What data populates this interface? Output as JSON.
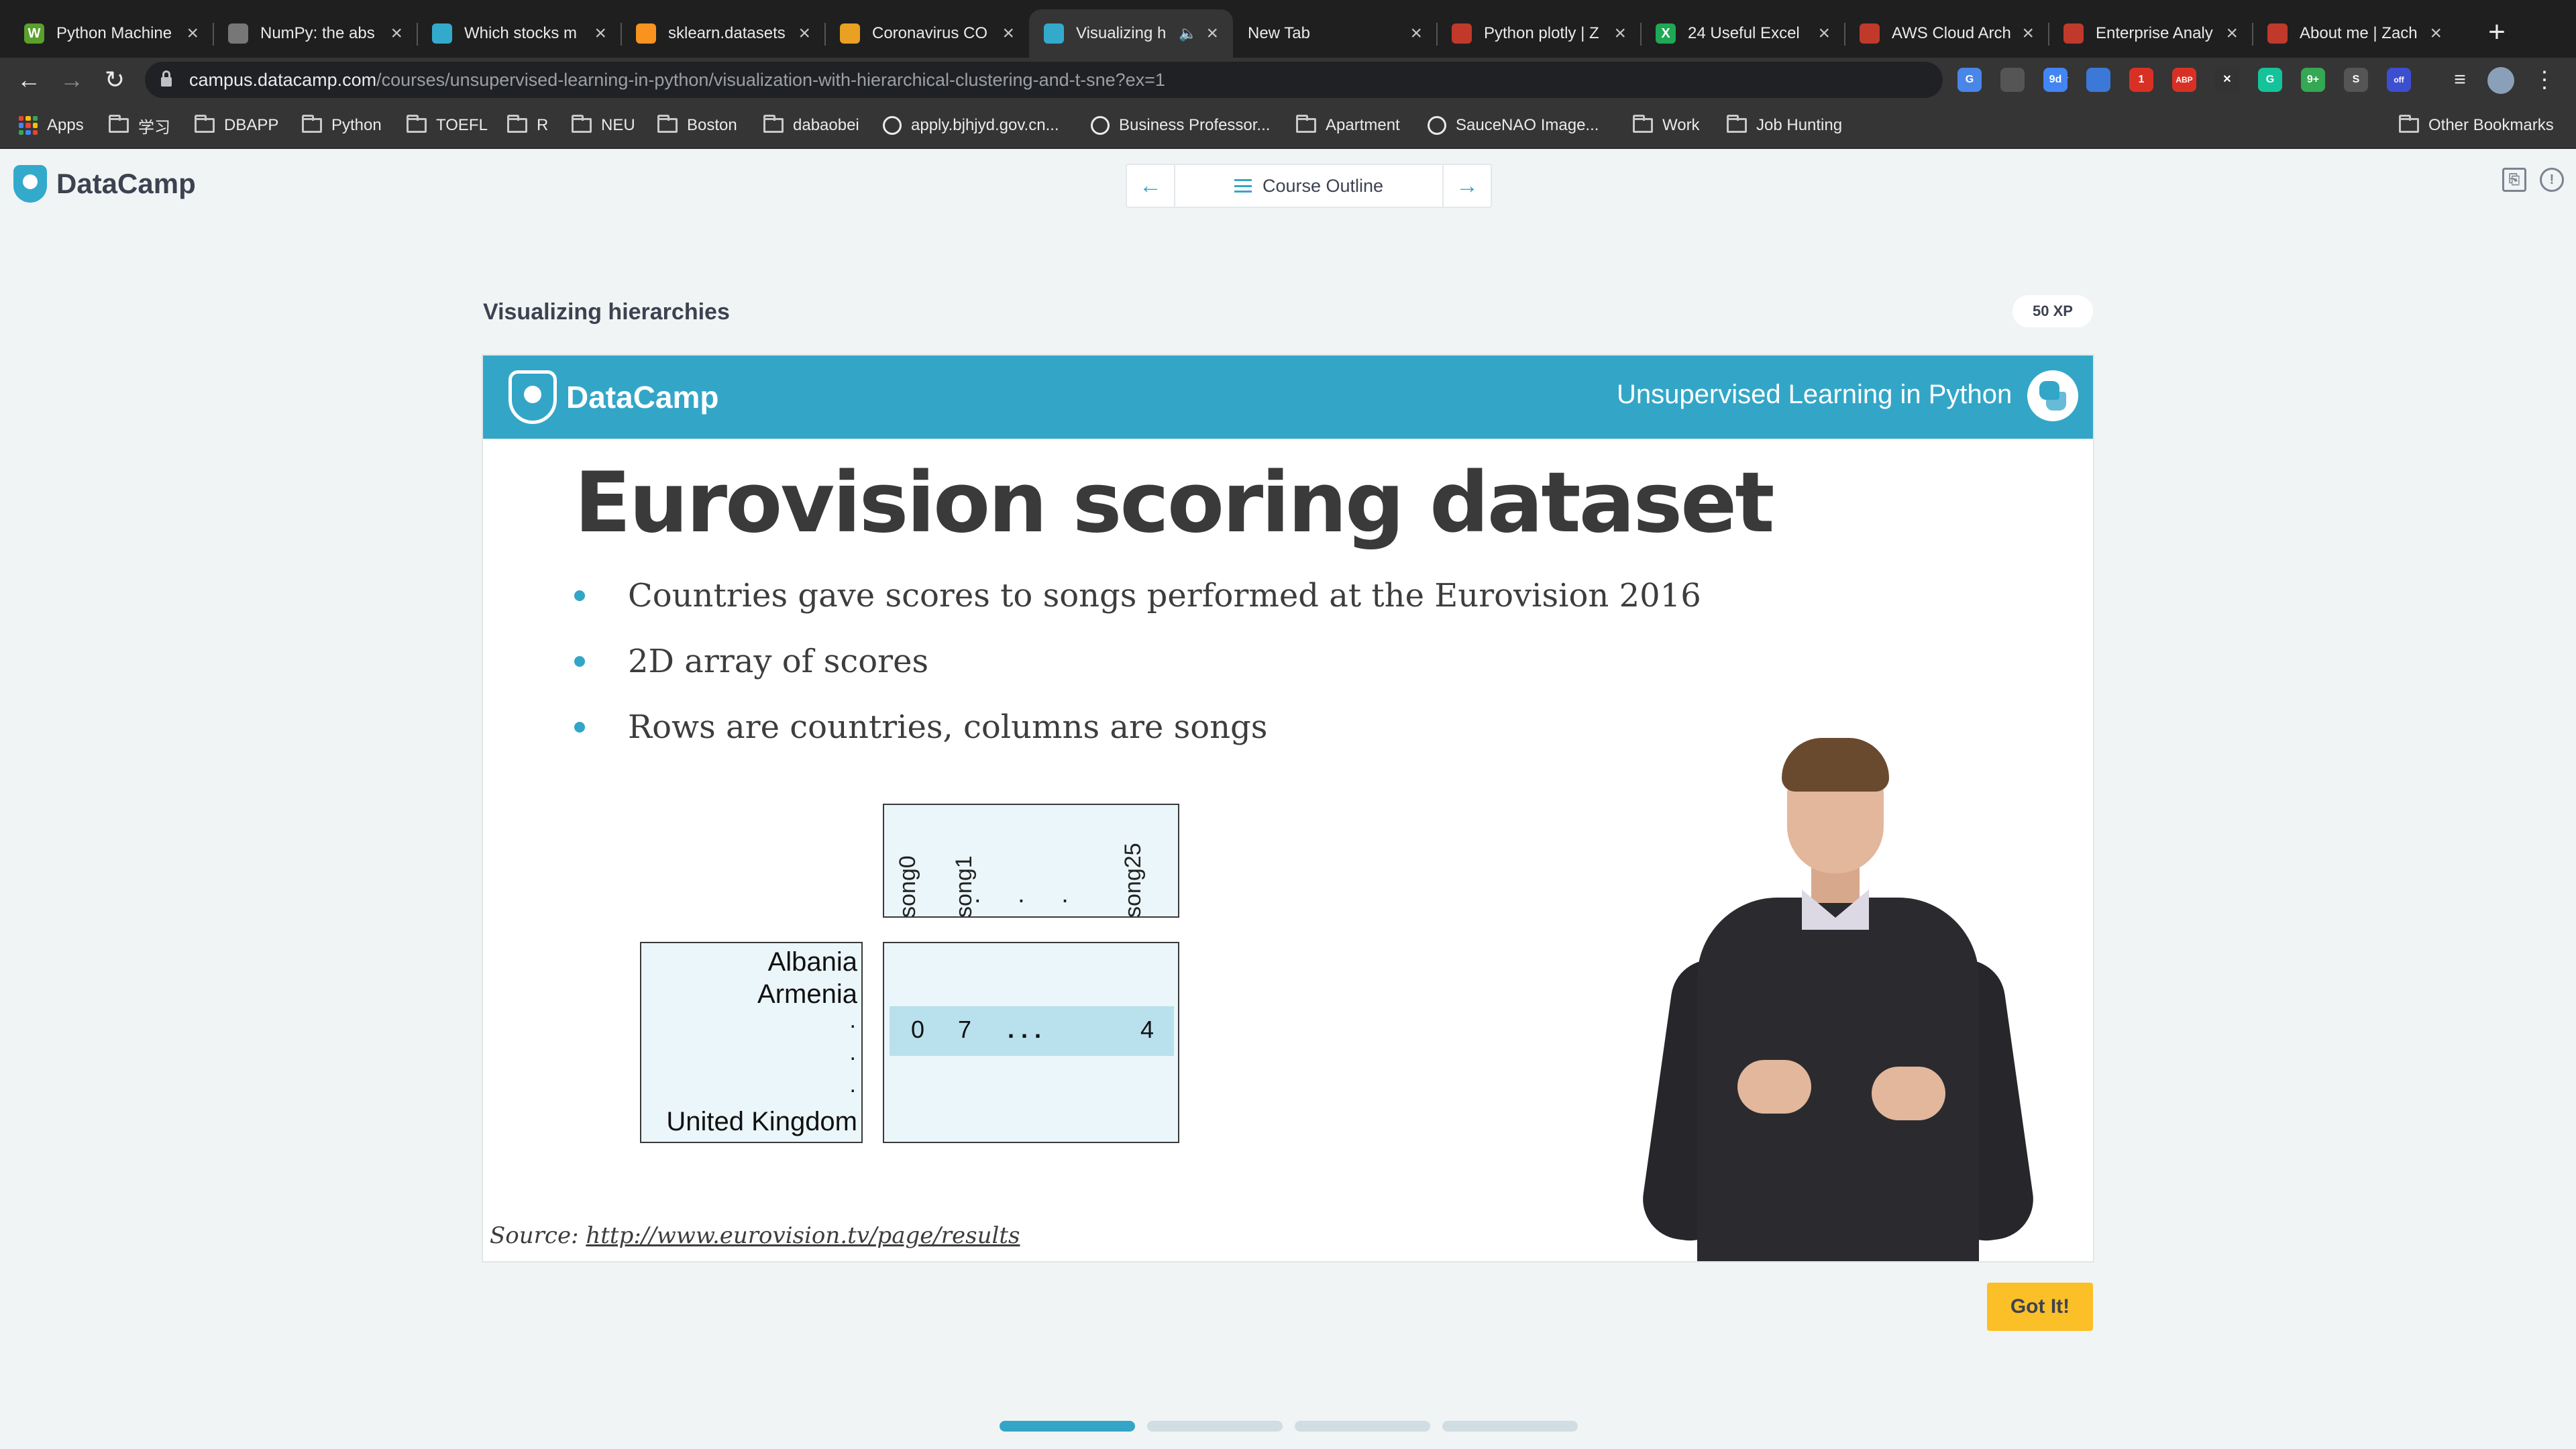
{
  "browser": {
    "tabs": [
      {
        "title": "Python Machine",
        "active": false,
        "fav_color": "#5aa02c",
        "fav_text": "W"
      },
      {
        "title": "NumPy: the abs",
        "active": false,
        "fav_color": "#777777",
        "fav_text": ""
      },
      {
        "title": "Which stocks m",
        "active": false,
        "fav_color": "#3ac",
        "fav_text": ""
      },
      {
        "title": "sklearn.datasets",
        "active": false,
        "fav_color": "#f7931e",
        "fav_text": ""
      },
      {
        "title": "Coronavirus CO",
        "active": false,
        "fav_color": "#e9a023",
        "fav_text": ""
      },
      {
        "title": "Visualizing h",
        "active": true,
        "fav_color": "#3ac",
        "fav_text": ""
      },
      {
        "title": "New Tab",
        "active": false,
        "fav_color": "",
        "fav_text": ""
      },
      {
        "title": "Python plotly | Z",
        "active": false,
        "fav_color": "#c0392b",
        "fav_text": ""
      },
      {
        "title": "24 Useful Excel",
        "active": false,
        "fav_color": "#1fa855",
        "fav_text": "X"
      },
      {
        "title": "AWS Cloud Arch",
        "active": false,
        "fav_color": "#c0392b",
        "fav_text": ""
      },
      {
        "title": "Enterprise Analy",
        "active": false,
        "fav_color": "#c0392b",
        "fav_text": ""
      },
      {
        "title": "About me | Zach",
        "active": false,
        "fav_color": "#c0392b",
        "fav_text": ""
      }
    ],
    "url_host": "campus.datacamp.com",
    "url_path": "/courses/unsupervised-learning-in-python/visualization-with-hierarchical-clustering-and-t-sne?ex=1",
    "extensions": [
      {
        "name": "translate-icon",
        "color": "#4a86e8",
        "text": "G"
      },
      {
        "name": "pin-icon",
        "color": "#555555",
        "text": ""
      },
      {
        "name": "calendar-icon",
        "color": "#4285f4",
        "text": "9d"
      },
      {
        "name": "ext-blue-icon",
        "color": "#3c78d8",
        "text": ""
      },
      {
        "name": "pinterest-icon",
        "color": "#d93025",
        "text": "1"
      },
      {
        "name": "adblock-icon",
        "color": "#d93025",
        "text": "ABP"
      },
      {
        "name": "x-ext-icon",
        "color": "#333333",
        "text": "✕"
      },
      {
        "name": "grammarly-icon",
        "color": "#15c39a",
        "text": "G"
      },
      {
        "name": "ext-green-icon",
        "color": "#34a853",
        "text": "9+"
      },
      {
        "name": "ext-circle-icon",
        "color": "#555555",
        "text": "S"
      },
      {
        "name": "ext-off-icon",
        "color": "#3c4fd1",
        "text": "off"
      }
    ],
    "bookmarks": [
      {
        "label": "Apps",
        "kind": "apps"
      },
      {
        "label": "学习",
        "kind": "folder"
      },
      {
        "label": "DBAPP",
        "kind": "folder"
      },
      {
        "label": "Python",
        "kind": "folder"
      },
      {
        "label": "TOEFL",
        "kind": "folder"
      },
      {
        "label": "R",
        "kind": "folder"
      },
      {
        "label": "NEU",
        "kind": "folder"
      },
      {
        "label": "Boston",
        "kind": "folder"
      },
      {
        "label": "dabaobei",
        "kind": "folder"
      },
      {
        "label": "apply.bjhjyd.gov.cn...",
        "kind": "globe"
      },
      {
        "label": "Business Professor...",
        "kind": "globe"
      },
      {
        "label": "Apartment",
        "kind": "folder"
      },
      {
        "label": "SauceNAO Image...",
        "kind": "globe"
      },
      {
        "label": "Work",
        "kind": "folder"
      },
      {
        "label": "Job Hunting",
        "kind": "folder"
      }
    ],
    "other_bookmarks": "Other Bookmarks"
  },
  "datacamp": {
    "logo": "DataCamp",
    "course_outline": "Course Outline"
  },
  "exercise": {
    "title": "Visualizing hierarchies",
    "xp": "50 XP",
    "got_it": "Got It!",
    "progress": {
      "total": 4,
      "current": 1
    }
  },
  "slide": {
    "logo": "DataCamp",
    "course": "Unsupervised Learning in Python",
    "title": "Eurovision scoring dataset",
    "bullets": [
      "Countries gave scores to songs performed at the Eurovision 2016",
      "2D array of scores",
      "Rows are countries, columns are songs"
    ],
    "diagram": {
      "columns": [
        "song0",
        "song1",
        "song25"
      ],
      "col_ellipsis": ". . .",
      "rows_top": [
        "Albania",
        "Armenia"
      ],
      "row_ellipsis": ".",
      "row_last": "United Kingdom",
      "values": [
        "0",
        "7",
        ". . .",
        "4"
      ]
    },
    "source_label": "Source:",
    "source_url": "http://www.eurovision.tv/page/results"
  }
}
